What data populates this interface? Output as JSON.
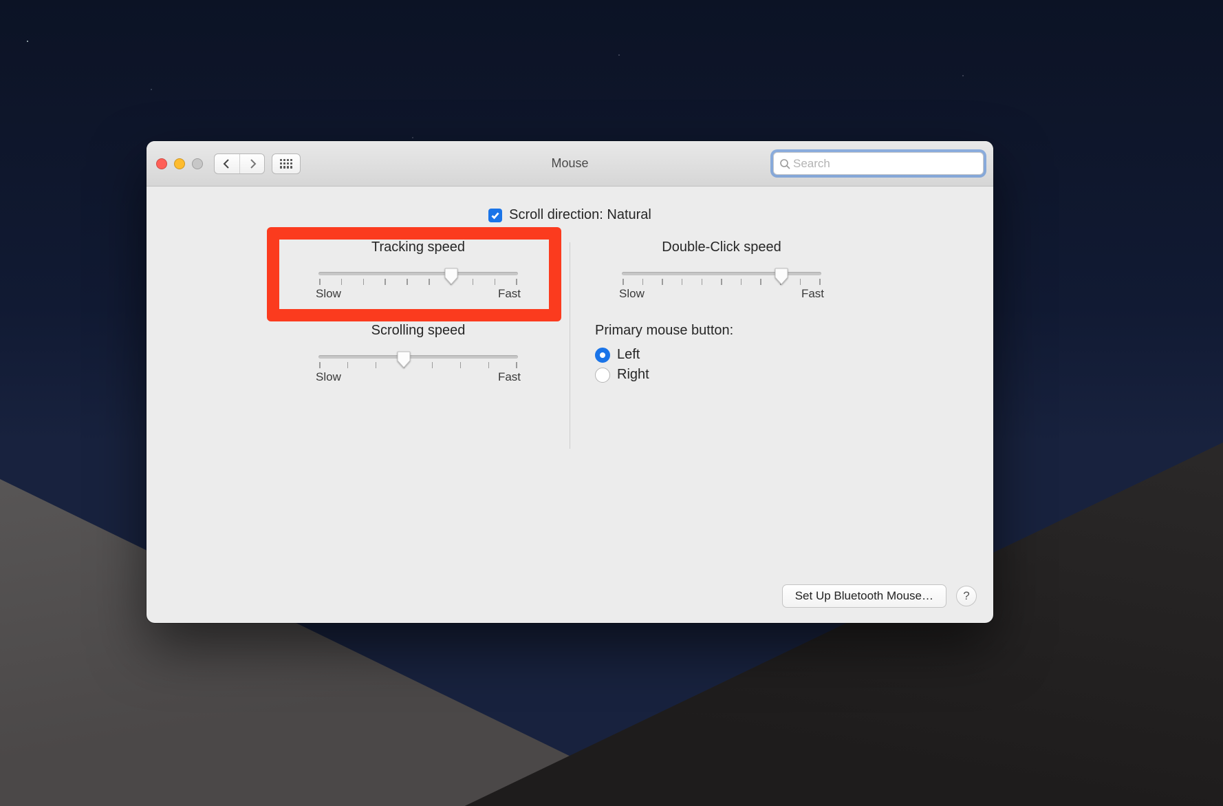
{
  "window": {
    "title": "Mouse"
  },
  "search": {
    "placeholder": "Search",
    "value": ""
  },
  "scroll_direction": {
    "label": "Scroll direction: Natural",
    "checked": true
  },
  "sliders": {
    "tracking": {
      "title": "Tracking speed",
      "min_label": "Slow",
      "max_label": "Fast",
      "ticks": 10,
      "value": 6
    },
    "doubleclick": {
      "title": "Double-Click speed",
      "min_label": "Slow",
      "max_label": "Fast",
      "ticks": 11,
      "value": 8
    },
    "scrolling": {
      "title": "Scrolling speed",
      "min_label": "Slow",
      "max_label": "Fast",
      "ticks": 8,
      "value": 3
    }
  },
  "primary_button": {
    "title": "Primary mouse button:",
    "options": {
      "left": "Left",
      "right": "Right"
    },
    "selected": "left"
  },
  "footer": {
    "bluetooth": "Set Up Bluetooth Mouse…",
    "help": "?"
  },
  "highlight": {
    "target": "tracking"
  }
}
